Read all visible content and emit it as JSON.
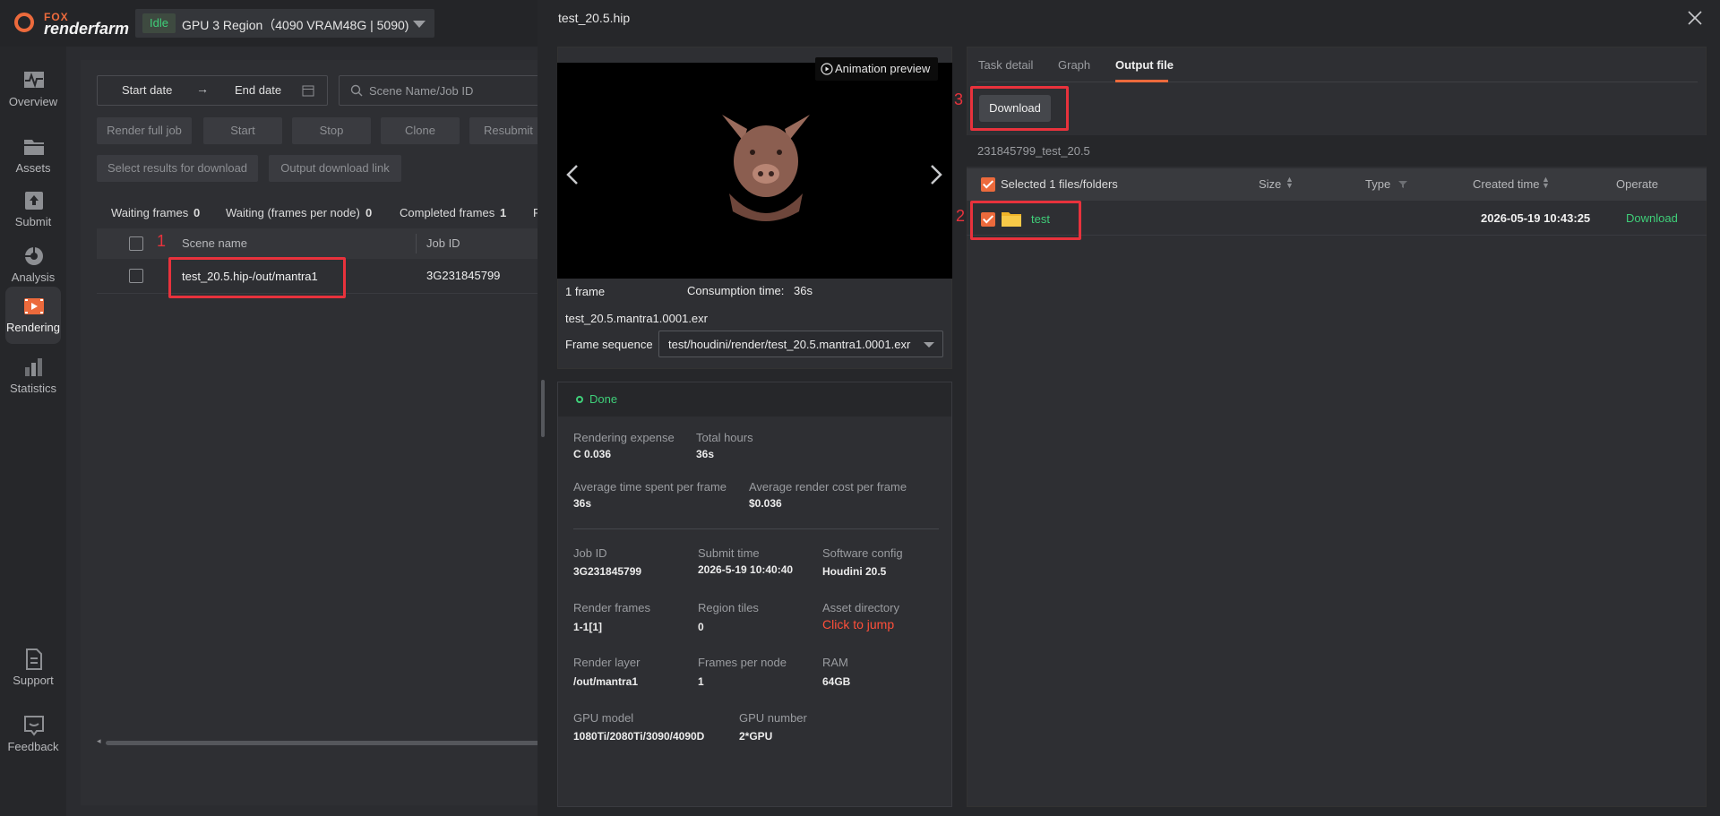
{
  "app": {
    "logo_top": "FOX",
    "logo_bottom": "renderfarm",
    "status_badge": "Idle",
    "region": "GPU 3 Region（4090 VRAM48G | 5090)"
  },
  "sidebar": {
    "items": [
      {
        "label": "Overview",
        "icon": "pulse-icon"
      },
      {
        "label": "Assets",
        "icon": "folder-icon"
      },
      {
        "label": "Submit",
        "icon": "upload-icon"
      },
      {
        "label": "Analysis",
        "icon": "analysis-icon"
      },
      {
        "label": "Rendering",
        "icon": "film-icon"
      },
      {
        "label": "Statistics",
        "icon": "bar-chart-icon"
      },
      {
        "label": "Support",
        "icon": "document-icon"
      },
      {
        "label": "Feedback",
        "icon": "feedback-icon"
      }
    ]
  },
  "jobs": {
    "start_date": "Start date",
    "end_date": "End date",
    "search_placeholder": "Scene Name/Job ID",
    "buttons": [
      "Render full job",
      "Start",
      "Stop",
      "Clone",
      "Resubmit"
    ],
    "buttons2": [
      "Select results for download",
      "Output download link"
    ],
    "stats": {
      "waiting_frames_label": "Waiting frames",
      "waiting_frames": "0",
      "waiting_per_node_label": "Waiting (frames per node)",
      "waiting_per_node": "0",
      "completed_label": "Completed frames",
      "completed": "1",
      "f_trunc": "F"
    },
    "columns": [
      "Scene name",
      "Job ID"
    ],
    "rows": [
      {
        "scene": "test_20.5.hip-/out/mantra1",
        "job_id": "3G231845799"
      }
    ],
    "annotation": "1"
  },
  "modal": {
    "title": "test_20.5.hip",
    "animation_preview": "Animation preview",
    "frames": "1 frame",
    "consumption_label": "Consumption time:",
    "consumption": "36s",
    "file_name": "test_20.5.mantra1.0001.exr",
    "frame_sequence_label": "Frame sequence",
    "frame_sequence_value": "test/houdini/render/test_20.5.mantra1.0001.exr",
    "status": "Done",
    "info": {
      "rendering_expense_label": "Rendering expense",
      "rendering_expense": "C 0.036",
      "total_hours_label": "Total hours",
      "total_hours": "36s",
      "avg_time_label": "Average time spent per frame",
      "avg_time": "36s",
      "avg_cost_label": "Average render cost per frame",
      "avg_cost": "$0.036",
      "job_id_label": "Job ID",
      "job_id": "3G231845799",
      "submit_time_label": "Submit time",
      "submit_time": "2026-5-19 10:40:40",
      "software_label": "Software config",
      "software": "Houdini 20.5",
      "render_frames_label": "Render frames",
      "render_frames": "1-1[1]",
      "region_tiles_label": "Region tiles",
      "region_tiles": "0",
      "asset_dir_label": "Asset directory",
      "asset_dir": "Click to jump",
      "render_layer_label": "Render layer",
      "render_layer": "/out/mantra1",
      "frames_per_node_label": "Frames per node",
      "frames_per_node": "1",
      "ram_label": "RAM",
      "ram": "64GB",
      "gpu_model_label": "GPU model",
      "gpu_model": "1080Ti/2080Ti/3090/4090D",
      "gpu_number_label": "GPU number",
      "gpu_number": "2*GPU"
    }
  },
  "output": {
    "tabs": [
      "Task detail",
      "Graph",
      "Output file"
    ],
    "active_tab": "Output file",
    "download": "Download",
    "path": "231845799_test_20.5",
    "selected": "Selected 1 files/folders",
    "columns": {
      "size": "Size",
      "type": "Type",
      "created": "Created time",
      "operate": "Operate"
    },
    "rows": [
      {
        "name": "test",
        "created": "2026-05-19 10:43:25",
        "action": "Download"
      }
    ],
    "annotation_2": "2",
    "annotation_3": "3"
  },
  "colors": {
    "accent": "#ec6a3c",
    "success": "#3fcf79",
    "highlight": "#e8323c",
    "link": "#ff4f3a"
  }
}
